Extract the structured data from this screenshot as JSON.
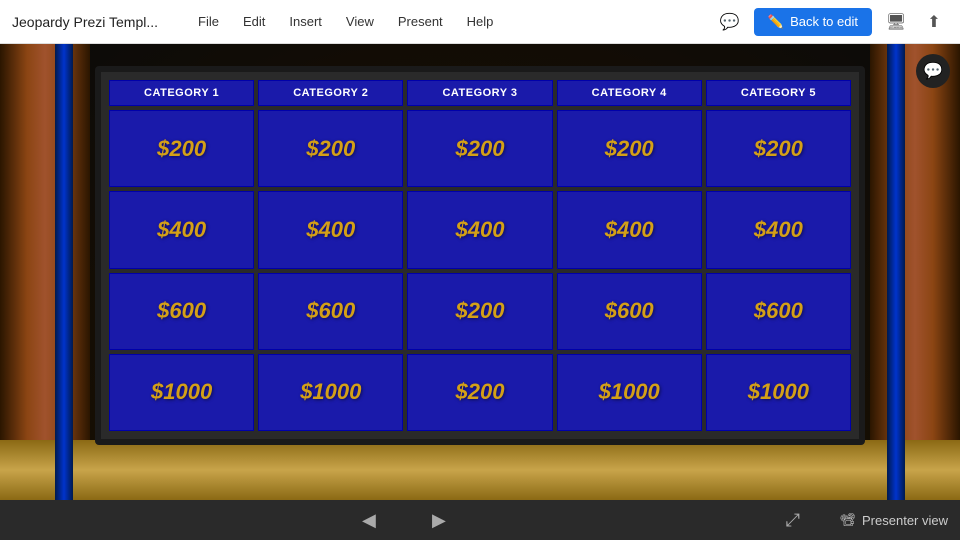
{
  "app": {
    "title": "Jeopardy Prezi Templ...",
    "menu": {
      "file": "File",
      "edit": "Edit",
      "insert": "Insert",
      "view": "View",
      "present": "Present",
      "help": "Help"
    },
    "back_to_edit": "Back to edit",
    "presenter_view": "Presenter view"
  },
  "board": {
    "categories": [
      "CATEGORY 1",
      "CATEGORY 2",
      "CATEGORY 3",
      "CATEGORY 4",
      "CATEGORY 5"
    ],
    "rows": [
      [
        "$200",
        "$200",
        "$200",
        "$200",
        "$200"
      ],
      [
        "$400",
        "$400",
        "$400",
        "$400",
        "$400"
      ],
      [
        "$600",
        "$600",
        "$200",
        "$600",
        "$600"
      ],
      [
        "$1000",
        "$1000",
        "$200",
        "$1000",
        "$1000"
      ]
    ]
  },
  "nav": {
    "prev": "◀",
    "next": "▶"
  }
}
